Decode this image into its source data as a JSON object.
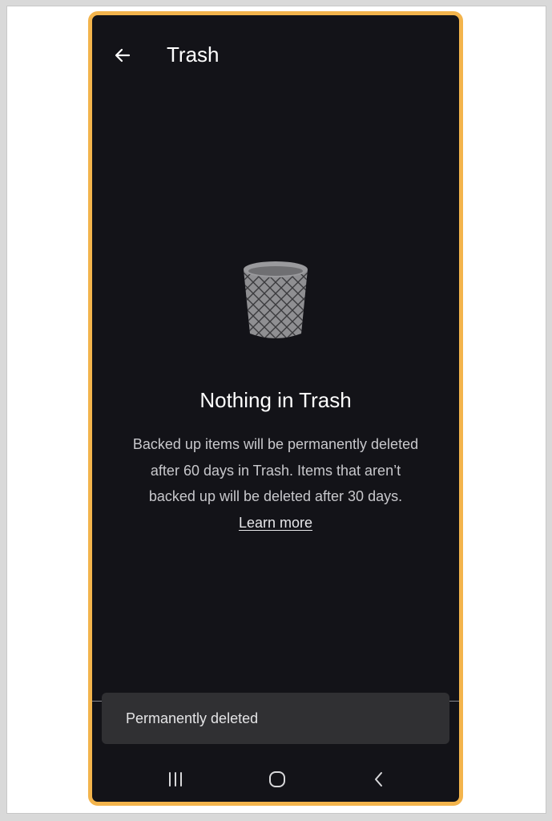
{
  "app_bar": {
    "title": "Trash",
    "back_icon": "arrow-left-icon"
  },
  "empty_state": {
    "illustration": "trash-bin-icon",
    "title": "Nothing in Trash",
    "body_text": "Backed up items will be permanently deleted after 60 days in Trash. Items that aren’t backed up will be deleted after 30 days.",
    "link_text": "Learn more"
  },
  "snackbar": {
    "text": "Permanently deleted"
  },
  "nav_bar": {
    "recents_icon": "recents-icon",
    "home_icon": "home-icon",
    "back_icon": "chevron-left-icon"
  },
  "colors": {
    "frame_accent": "#f3b44c",
    "background": "#131318",
    "snackbar_bg": "#303033"
  }
}
